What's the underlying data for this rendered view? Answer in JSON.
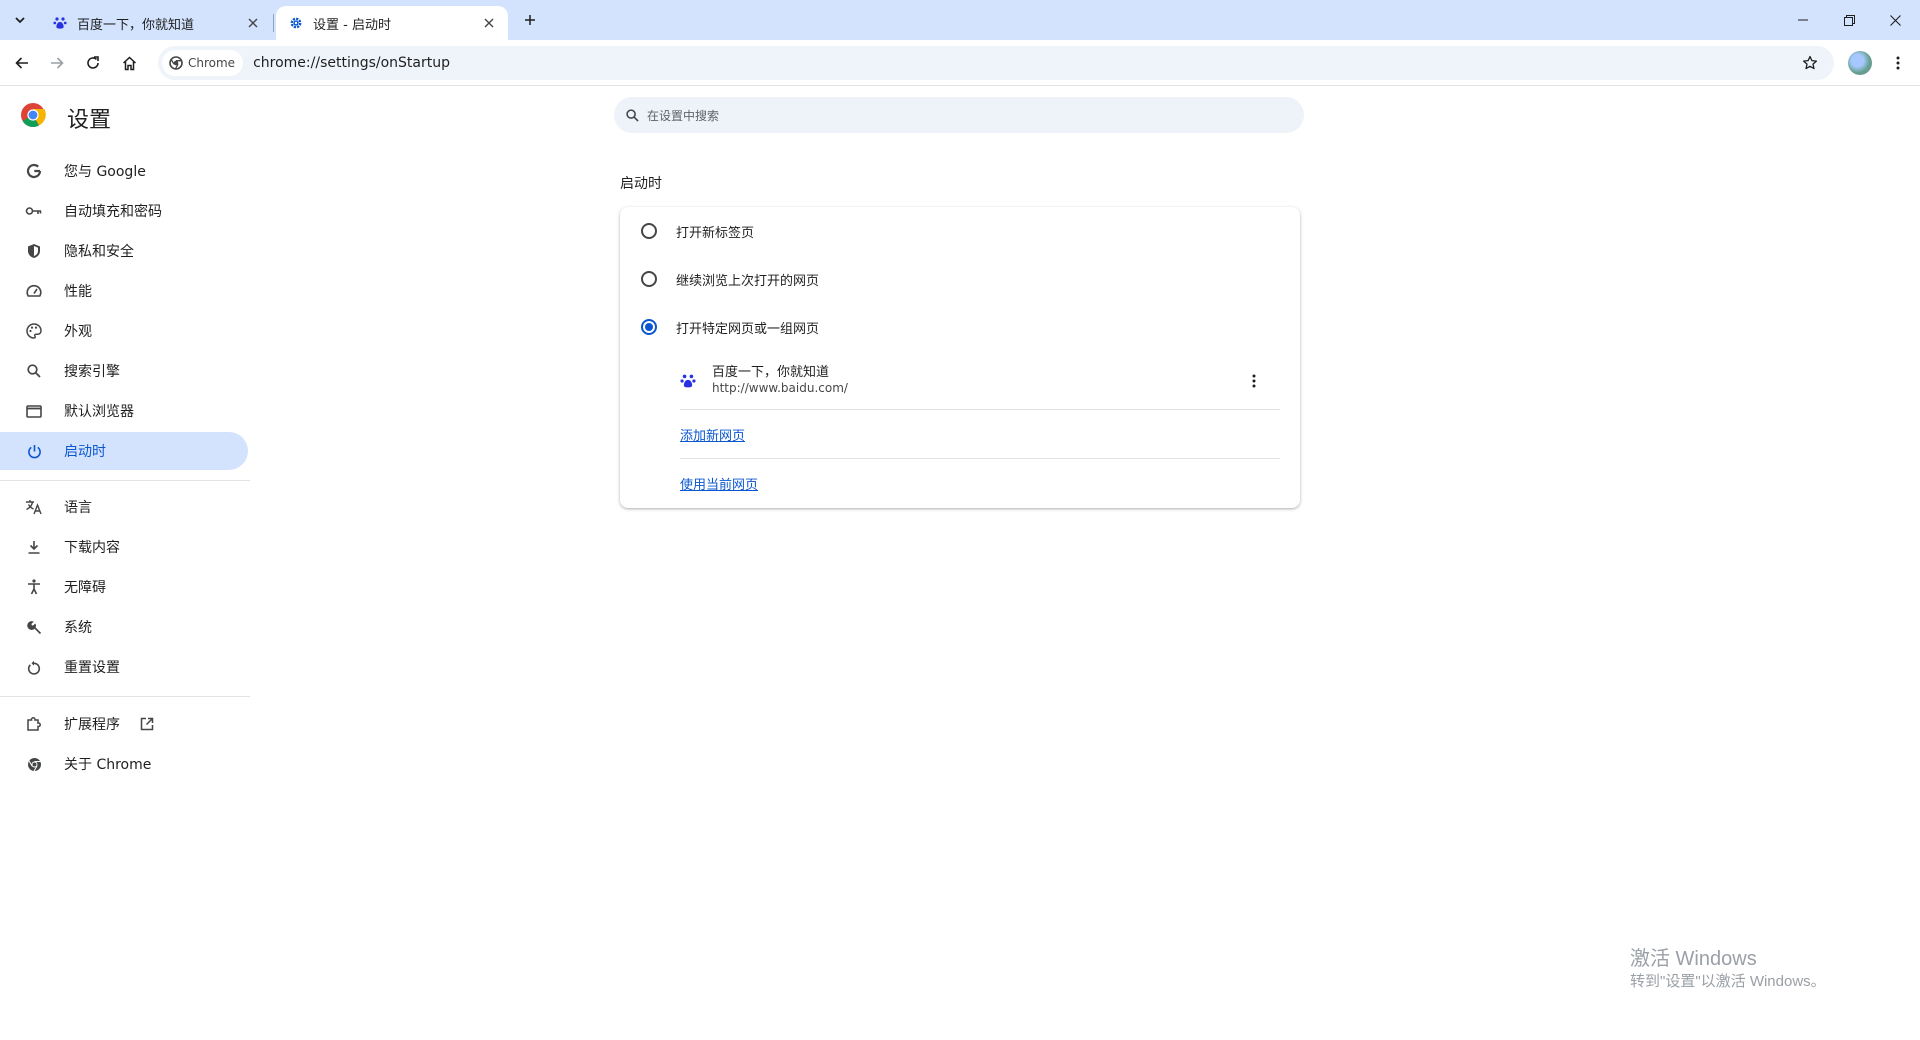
{
  "tabs": [
    {
      "title": "百度一下，你就知道",
      "favicon": "baidu-paw-icon",
      "active": false
    },
    {
      "title": "设置 - 启动时",
      "favicon": "gear-icon",
      "active": true
    }
  ],
  "toolbar": {
    "chip_label": "Chrome",
    "url": "chrome://settings/onStartup"
  },
  "sidebar": {
    "title": "设置",
    "items": [
      {
        "label": "您与 Google",
        "icon": "google-g-icon"
      },
      {
        "label": "自动填充和密码",
        "icon": "key-icon"
      },
      {
        "label": "隐私和安全",
        "icon": "shield-icon"
      },
      {
        "label": "性能",
        "icon": "speedometer-icon"
      },
      {
        "label": "外观",
        "icon": "palette-icon"
      },
      {
        "label": "搜索引擎",
        "icon": "search-icon"
      },
      {
        "label": "默认浏览器",
        "icon": "browser-window-icon"
      },
      {
        "label": "启动时",
        "icon": "power-icon",
        "selected": true
      },
      {
        "label": "语言",
        "icon": "translate-icon"
      },
      {
        "label": "下载内容",
        "icon": "download-icon"
      },
      {
        "label": "无障碍",
        "icon": "accessibility-icon"
      },
      {
        "label": "系统",
        "icon": "wrench-icon"
      },
      {
        "label": "重置设置",
        "icon": "reset-icon"
      },
      {
        "label": "扩展程序",
        "icon": "puzzle-icon"
      },
      {
        "label": "关于 Chrome",
        "icon": "chrome-icon"
      }
    ]
  },
  "search": {
    "placeholder": "在设置中搜索"
  },
  "startup": {
    "section_title": "启动时",
    "options": [
      {
        "label": "打开新标签页",
        "checked": false
      },
      {
        "label": "继续浏览上次打开的网页",
        "checked": false
      },
      {
        "label": "打开特定网页或一组网页",
        "checked": true
      }
    ],
    "site": {
      "name": "百度一下，你就知道",
      "url": "http://www.baidu.com/"
    },
    "add_link": "添加新网页",
    "use_current_link": "使用当前网页"
  },
  "watermark": {
    "line1": "激活 Windows",
    "line2": "转到\"设置\"以激活 Windows。"
  },
  "colors": {
    "accent": "#0b57d0",
    "tabstrip": "#d3e3fd",
    "selected_nav": "#d3e3fd"
  }
}
